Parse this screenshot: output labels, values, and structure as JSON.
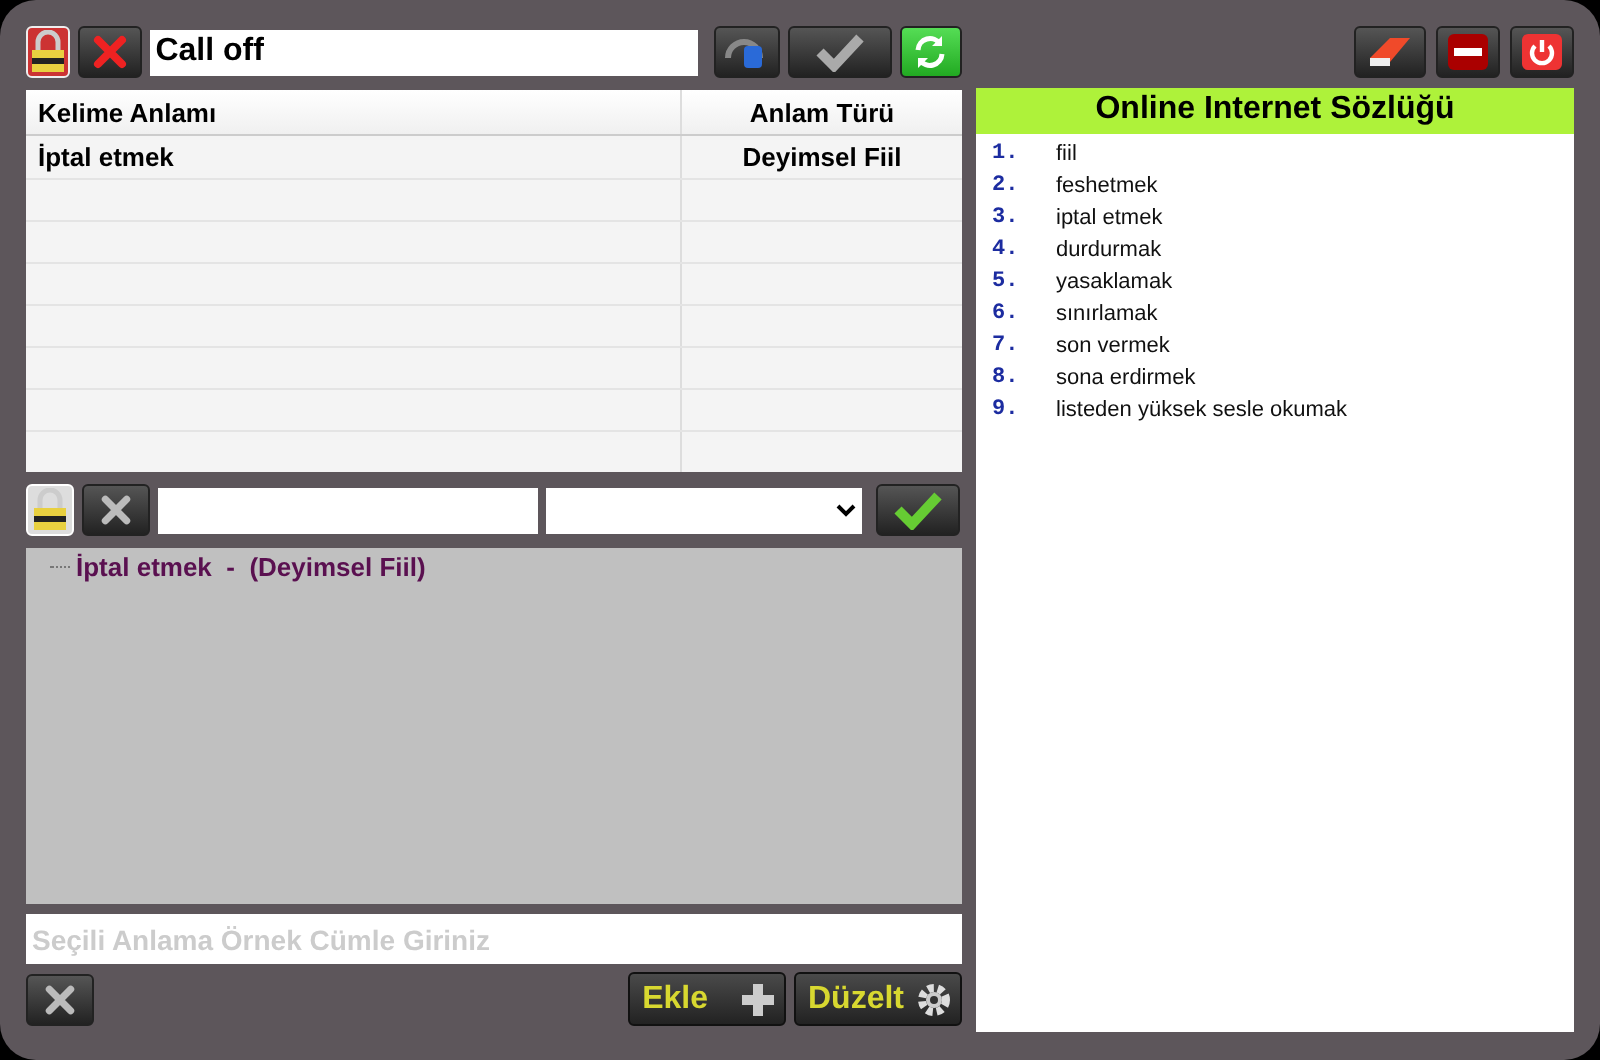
{
  "search": {
    "value": "Call off"
  },
  "table": {
    "columns": [
      "Kelime Anlamı",
      "Anlam Türü"
    ],
    "rows": [
      {
        "cells": [
          "İptal etmek",
          "Deyimsel Fiil"
        ]
      }
    ]
  },
  "tree": [
    {
      "label": "İptal etmek  -  (Deyimsel Fiil)"
    }
  ],
  "example": {
    "placeholder": "Seçili Anlama Örnek Cümle Giriniz"
  },
  "actions": [
    {
      "label": "Ekle",
      "kind": "add"
    },
    {
      "label": "Düzelt",
      "kind": "edit"
    }
  ],
  "dictionary": {
    "title": "Online Internet Sözlüğü",
    "entries": [
      {
        "number": "1.",
        "text": "fiil"
      },
      {
        "number": "2.",
        "text": "feshetmek"
      },
      {
        "number": "3.",
        "text": "iptal etmek"
      },
      {
        "number": "4.",
        "text": "durdurmak"
      },
      {
        "number": "5.",
        "text": "yasaklamak"
      },
      {
        "number": "6.",
        "text": "sınırlamak"
      },
      {
        "number": "7.",
        "text": "son vermek"
      },
      {
        "number": "8.",
        "text": "sona erdirmek"
      },
      {
        "number": "9.",
        "text": "listeden yüksek sesle okumak"
      }
    ]
  }
}
